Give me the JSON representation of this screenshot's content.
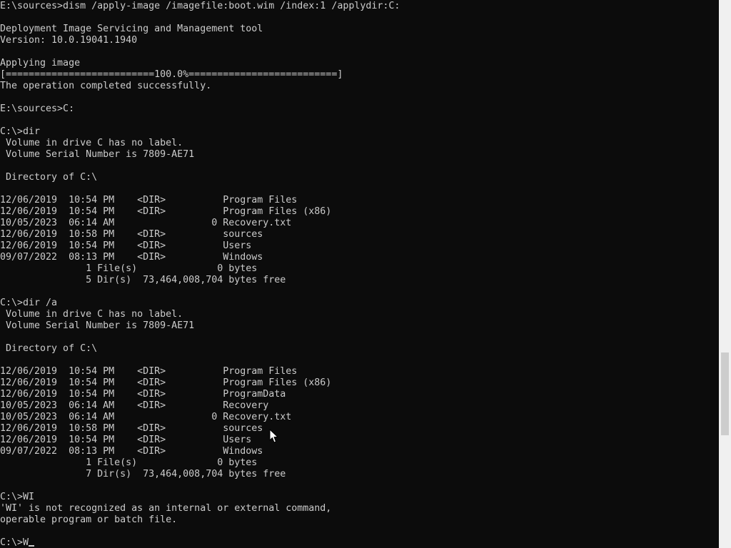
{
  "console": {
    "lines": [
      "E:\\sources>dism /apply-image /imagefile:boot.wim /index:1 /applydir:C:",
      "",
      "Deployment Image Servicing and Management tool",
      "Version: 10.0.19041.1940",
      "",
      "Applying image",
      "[==========================100.0%==========================]",
      "The operation completed successfully.",
      "",
      "E:\\sources>C:",
      "",
      "C:\\>dir",
      " Volume in drive C has no label.",
      " Volume Serial Number is 7809-AE71",
      "",
      " Directory of C:\\",
      "",
      "12/06/2019  10:54 PM    <DIR>          Program Files",
      "12/06/2019  10:54 PM    <DIR>          Program Files (x86)",
      "10/05/2023  06:14 AM                 0 Recovery.txt",
      "12/06/2019  10:58 PM    <DIR>          sources",
      "12/06/2019  10:54 PM    <DIR>          Users",
      "09/07/2022  08:13 PM    <DIR>          Windows",
      "               1 File(s)              0 bytes",
      "               5 Dir(s)  73,464,008,704 bytes free",
      "",
      "C:\\>dir /a",
      " Volume in drive C has no label.",
      " Volume Serial Number is 7809-AE71",
      "",
      " Directory of C:\\",
      "",
      "12/06/2019  10:54 PM    <DIR>          Program Files",
      "12/06/2019  10:54 PM    <DIR>          Program Files (x86)",
      "12/06/2019  10:54 PM    <DIR>          ProgramData",
      "10/05/2023  06:14 AM    <DIR>          Recovery",
      "10/05/2023  06:14 AM                 0 Recovery.txt",
      "12/06/2019  10:58 PM    <DIR>          sources",
      "12/06/2019  10:54 PM    <DIR>          Users",
      "09/07/2022  08:13 PM    <DIR>          Windows",
      "               1 File(s)              0 bytes",
      "               7 Dir(s)  73,464,008,704 bytes free",
      "",
      "C:\\>WI",
      "'WI' is not recognized as an internal or external command,",
      "operable program or batch file.",
      ""
    ],
    "input_prefix": "C:\\>",
    "input_value": "W",
    "progress": 1.0
  },
  "colors": {
    "background": "#0c0c0c",
    "text": "#cccccc",
    "scrollbar_track": "#f0f0f0",
    "scrollbar_thumb": "#cdcdcd"
  },
  "icons": {
    "pointer": "mouse-pointer-icon"
  }
}
